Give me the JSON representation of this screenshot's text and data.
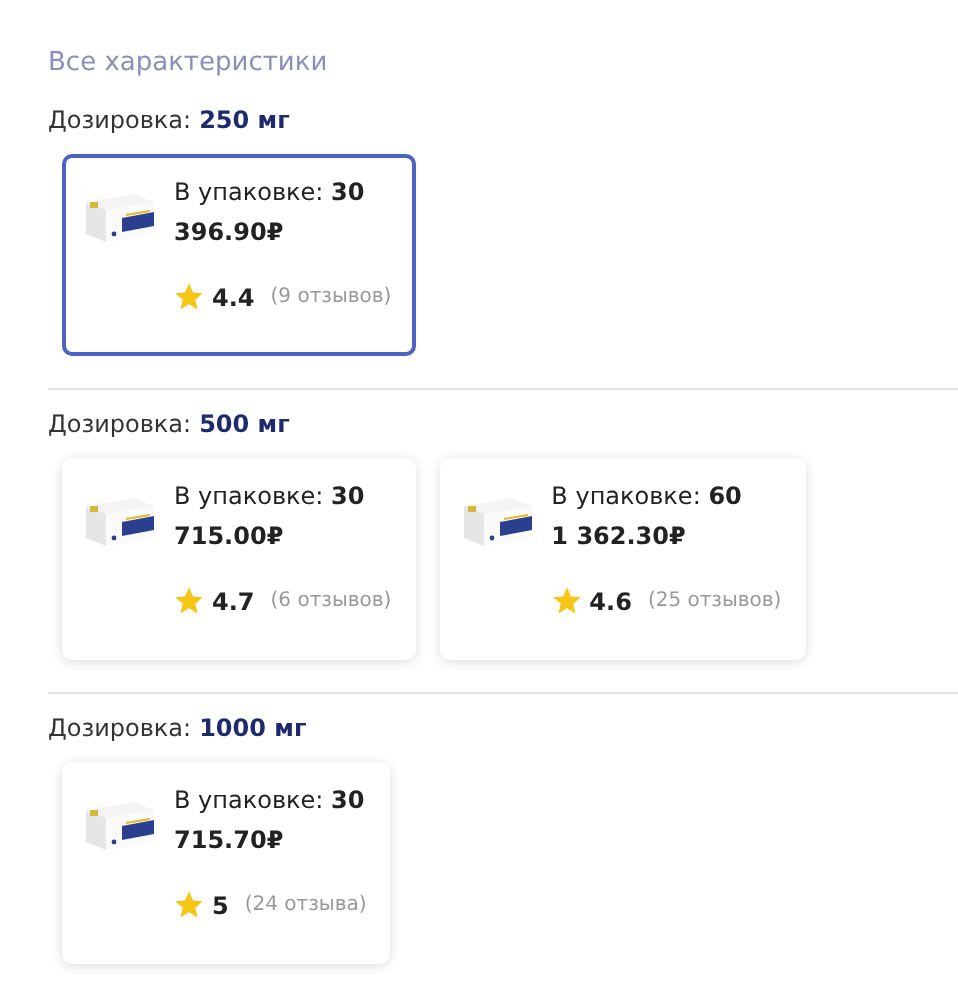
{
  "all_specs_link": "Все характеристики",
  "groups": [
    {
      "label": "Дозировка:",
      "value": "250 мг",
      "variants": [
        {
          "pack_label": "В упаковке:",
          "pack_count": "30",
          "price": "396.90",
          "currency": "₽",
          "rating": "4.4",
          "reviews": "(9 отзывов)",
          "selected": true
        }
      ]
    },
    {
      "label": "Дозировка:",
      "value": "500 мг",
      "variants": [
        {
          "pack_label": "В упаковке:",
          "pack_count": "30",
          "price": "715.00",
          "currency": "₽",
          "rating": "4.7",
          "reviews": "(6 отзывов)",
          "selected": false
        },
        {
          "pack_label": "В упаковке:",
          "pack_count": "60",
          "price": "1 362.30",
          "currency": "₽",
          "rating": "4.6",
          "reviews": "(25 отзывов)",
          "selected": false
        }
      ]
    },
    {
      "label": "Дозировка:",
      "value": "1000 мг",
      "variants": [
        {
          "pack_label": "В упаковке:",
          "pack_count": "30",
          "price": "715.70",
          "currency": "₽",
          "rating": "5",
          "reviews": "(24 отзыва)",
          "selected": false
        }
      ]
    }
  ]
}
